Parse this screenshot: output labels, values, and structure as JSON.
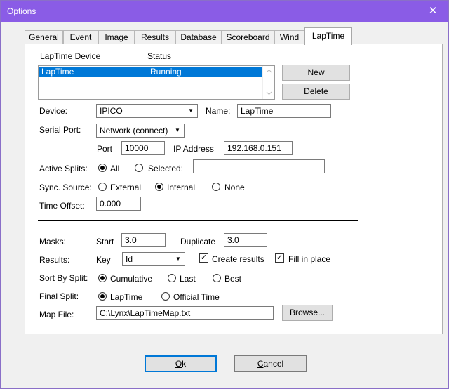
{
  "window": {
    "title": "Options",
    "close_glyph": "✕"
  },
  "tabs": [
    "General",
    "Event",
    "Image",
    "Results",
    "Database",
    "Scoreboard",
    "Wind",
    "LapTime"
  ],
  "active_tab": "LapTime",
  "device_list": {
    "header_device": "LapTime Device",
    "header_status": "Status",
    "rows": [
      {
        "device": "LapTime",
        "status": "Running"
      }
    ],
    "new_label": "New",
    "delete_label": "Delete"
  },
  "device": {
    "label": "Device:",
    "value": "IPICO",
    "name_label": "Name:",
    "name_value": "LapTime"
  },
  "serial_port": {
    "label": "Serial Port:",
    "value": "Network (connect)"
  },
  "port": {
    "label": "Port",
    "value": "10000"
  },
  "ip": {
    "label": "IP Address",
    "value": "192.168.0.151"
  },
  "active_splits": {
    "label": "Active Splits:",
    "options": [
      "All",
      "Selected:"
    ],
    "selected": "All",
    "selected_value": ""
  },
  "sync_source": {
    "label": "Sync. Source:",
    "options": [
      "External",
      "Internal",
      "None"
    ],
    "selected": "Internal"
  },
  "time_offset": {
    "label": "Time Offset:",
    "value": "0.000"
  },
  "masks": {
    "label": "Masks:",
    "start_label": "Start",
    "start_value": "3.0",
    "duplicate_label": "Duplicate",
    "duplicate_value": "3.0"
  },
  "results": {
    "label": "Results:",
    "key_label": "Key",
    "key_value": "Id",
    "create_results": "Create results",
    "fill_in_place": "Fill in place",
    "create_checked": true,
    "fill_checked": true
  },
  "sort_by_split": {
    "label": "Sort By Split:",
    "options": [
      "Cumulative",
      "Last",
      "Best"
    ],
    "selected": "Cumulative"
  },
  "final_split": {
    "label": "Final Split:",
    "options": [
      "LapTime",
      "Official Time"
    ],
    "selected": "LapTime"
  },
  "map_file": {
    "label": "Map File:",
    "value": "C:\\Lynx\\LapTimeMap.txt",
    "browse_label": "Browse..."
  },
  "buttons": {
    "ok_accel": "O",
    "ok_rest": "k",
    "cancel_accel": "C",
    "cancel_rest": "ancel"
  },
  "colors": {
    "titlebar": "#8a5ce6",
    "selection": "#0078d7"
  },
  "icons": {
    "close": "close-icon",
    "dropdown": "chevron-down-icon",
    "scroll_up": "chevron-up-icon",
    "scroll_down": "chevron-down-icon"
  }
}
